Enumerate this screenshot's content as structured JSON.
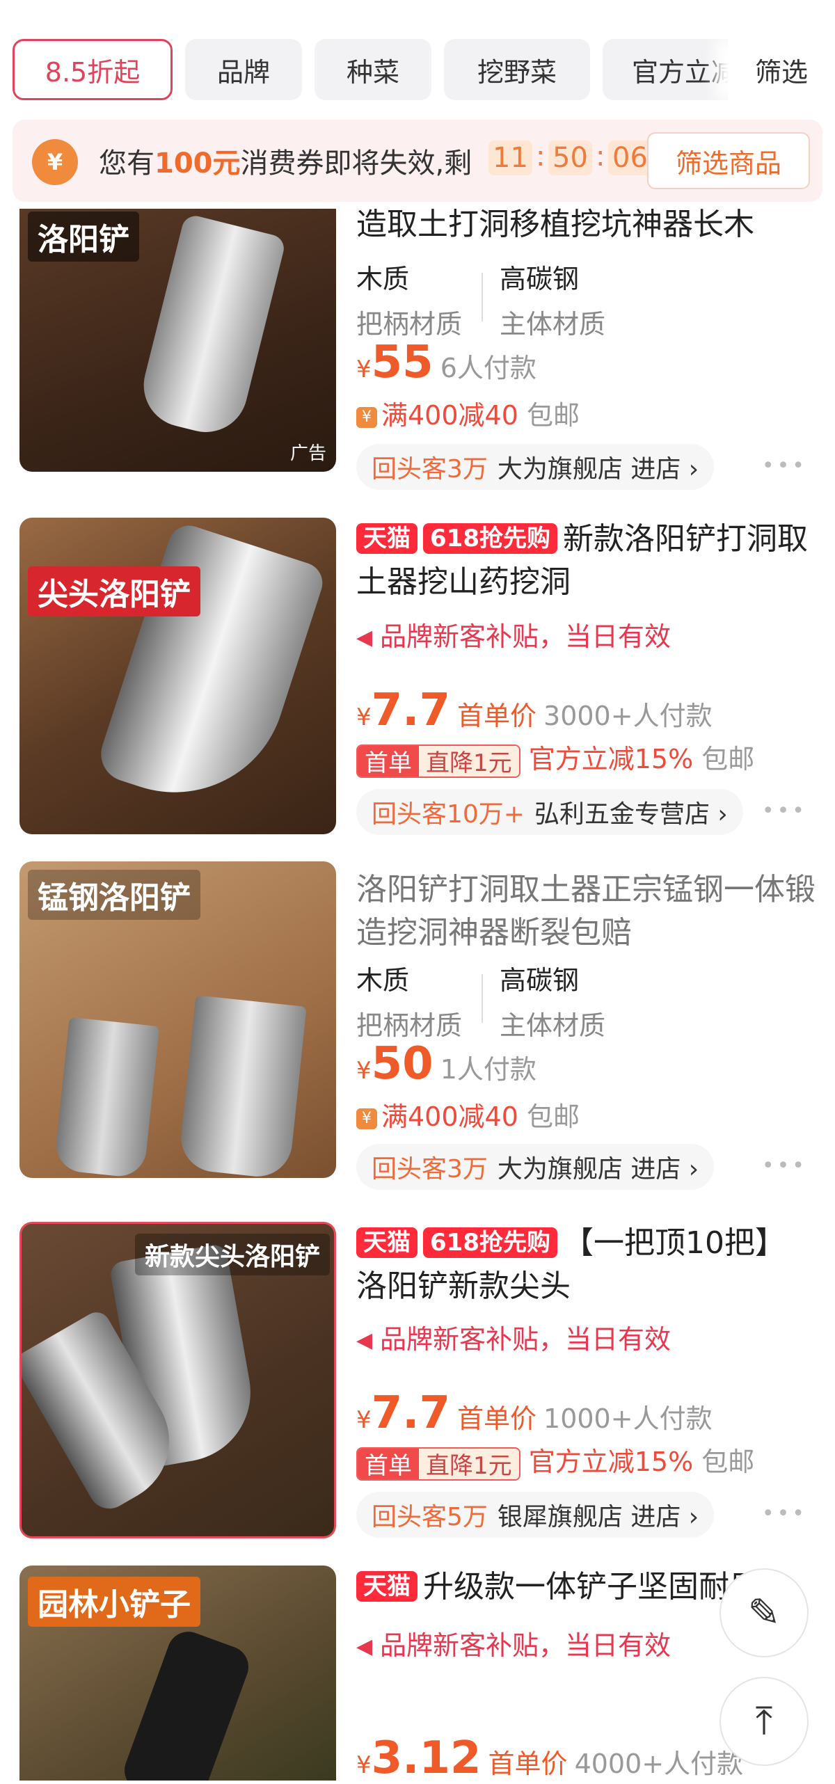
{
  "filters": {
    "chips": [
      "8.5折起",
      "品牌",
      "种菜",
      "挖野菜",
      "官方立减"
    ],
    "filter_label": "筛选"
  },
  "coupon": {
    "icon": "¥",
    "text_pre": "您有",
    "amount": "100元",
    "text_post": "消费券即将失效,剩",
    "hh": "11",
    "mm": "50",
    "ss": "06",
    "button": "筛选商品"
  },
  "items": [
    {
      "image_label": "洛阳铲",
      "ad_label": "广告",
      "title": "造取土打洞移植挖坑神器长木",
      "attr1_value": "木质",
      "attr1_key": "把柄材质",
      "attr2_value": "高碳钢",
      "attr2_key": "主体材质",
      "price_symbol": "¥",
      "price": "55",
      "sales": "6人付款",
      "promo": "满400减40",
      "shipping": "包邮",
      "returning": "回头客3万",
      "store": "大为旗舰店 进店 ›"
    },
    {
      "image_label": "尖头洛阳铲",
      "tag1": "天猫",
      "tag2": "618抢先购",
      "title": "新款洛阳铲打洞取土器挖山药挖洞",
      "subsidy": "品牌新客补贴，当日有效",
      "price_symbol": "¥",
      "price": "7.7",
      "price_type": "首单价",
      "sales": "3000+人付款",
      "first_label": "首单",
      "drop_label": "直降1元",
      "official": "官方立减15%",
      "shipping": "包邮",
      "returning": "回头客10万+",
      "store": "弘利五金专营店 ›"
    },
    {
      "image_label": "锰钢洛阳铲",
      "title": "洛阳铲打洞取土器正宗锰钢一体锻造挖洞神器断裂包赔",
      "attr1_value": "木质",
      "attr1_key": "把柄材质",
      "attr2_value": "高碳钢",
      "attr2_key": "主体材质",
      "price_symbol": "¥",
      "price": "50",
      "sales": "1人付款",
      "promo": "满400减40",
      "shipping": "包邮",
      "returning": "回头客3万",
      "store": "大为旗舰店 进店 ›"
    },
    {
      "image_label": "新款尖头洛阳铲",
      "tag1": "天猫",
      "tag2": "618抢先购",
      "title": "【一把顶10把】洛阳铲新款尖头",
      "subsidy": "品牌新客补贴，当日有效",
      "price_symbol": "¥",
      "price": "7.7",
      "price_type": "首单价",
      "sales": "1000+人付款",
      "first_label": "首单",
      "drop_label": "直降1元",
      "official": "官方立减15%",
      "shipping": "包邮",
      "returning": "回头客5万",
      "store": "银犀旗舰店 进店 ›"
    },
    {
      "image_label": "园林小铲子",
      "tag1": "天猫",
      "title": "升级款一体铲子坚固耐用",
      "subsidy": "品牌新客补贴，当日有效",
      "price_symbol": "¥",
      "price": "3.12",
      "price_type": "首单价",
      "sales": "4000+人付款"
    }
  ],
  "float_buttons": {
    "edit_icon": "✎",
    "top_icon": "⤒"
  },
  "colors": {
    "accent": "#e0435a",
    "price": "#f05a28",
    "tmall": "#ff2a3a"
  }
}
